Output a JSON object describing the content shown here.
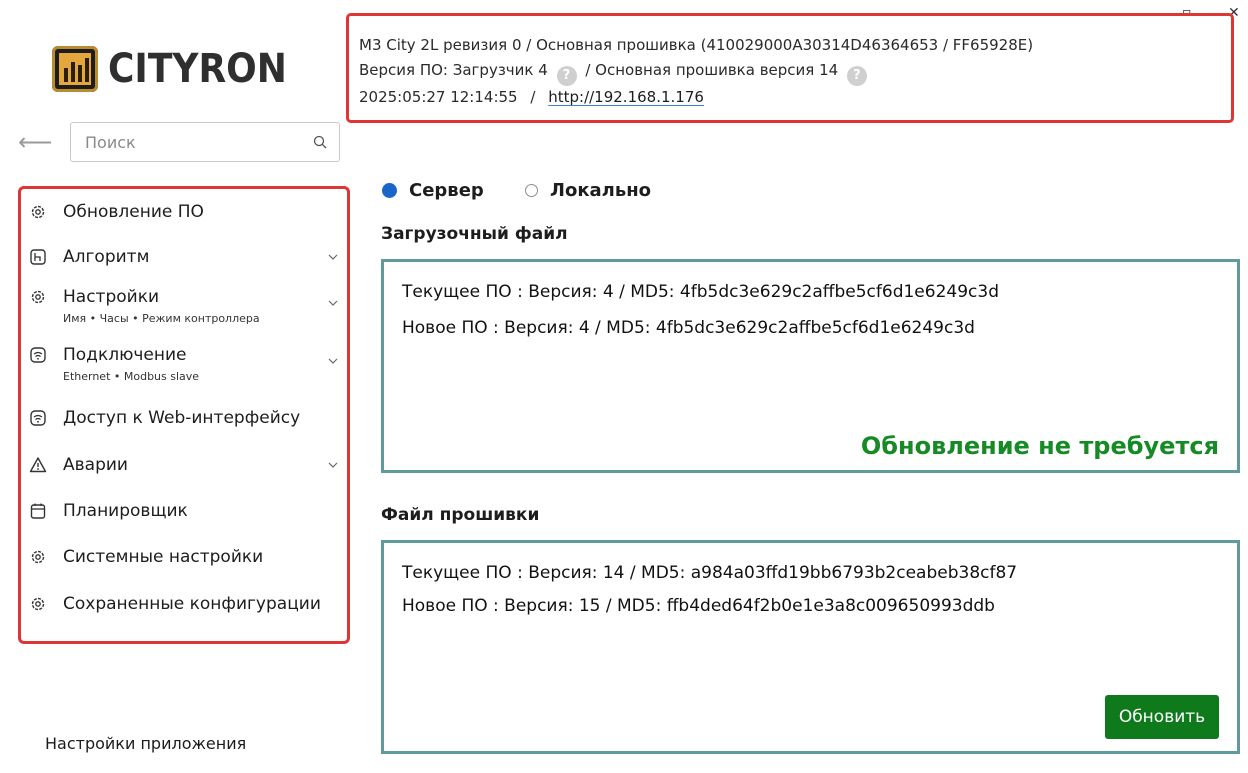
{
  "app": {
    "logo_text": "CITYRON",
    "window_restore": "▫",
    "window_close": "✕"
  },
  "search": {
    "placeholder": "Поиск"
  },
  "sidebar": {
    "items": [
      {
        "label": "Обновление ПО",
        "icon": "gear-icon"
      },
      {
        "label": "Алгоритм",
        "icon": "algorithm-icon",
        "expandable": true
      },
      {
        "label": "Настройки",
        "sub": "Имя • Часы • Режим контроллера",
        "icon": "gear-icon",
        "expandable": true
      },
      {
        "label": "Подключение",
        "sub": "Ethernet • Modbus slave",
        "icon": "wifi-icon",
        "expandable": true
      },
      {
        "label": "Доступ к Web-интерфейсу",
        "icon": "wifi-icon"
      },
      {
        "label": "Аварии",
        "icon": "warning-icon",
        "expandable": true
      },
      {
        "label": "Планировщик",
        "icon": "calendar-icon"
      },
      {
        "label": "Системные настройки",
        "icon": "gear-icon"
      },
      {
        "label": "Сохраненные конфигурации",
        "icon": "gear-icon"
      }
    ],
    "app_settings": "Настройки приложения"
  },
  "header": {
    "device": "M3 City 2L ревизия 0 / Основная прошивка (410029000A30314D46364653 / FF65928E)",
    "fw_prefix": "Версия ПО: Загрузчик 4",
    "fw_main": "/ Основная прошивка версия 14",
    "datetime": "2025:05:27 12:14:55",
    "separator": "/",
    "url": "http://192.168.1.176",
    "help_glyph": "?"
  },
  "source": {
    "server": "Сервер",
    "local": "Локально",
    "selected": "server"
  },
  "bootloader": {
    "title": "Загрузочный файл",
    "current": "Текущее ПО : Версия: 4 / MD5: 4fb5dc3e629c2affbe5cf6d1e6249c3d",
    "new": "Новое ПО : Версия: 4 / MD5: 4fb5dc3e629c2affbe5cf6d1e6249c3d",
    "status": "Обновление не требуется"
  },
  "firmware": {
    "title": "Файл прошивки",
    "current": "Текущее ПО : Версия: 14 / MD5: a984a03ffd19bb6793b2ceabeb38cf87",
    "new": "Новое ПО : Версия: 15 / MD5: ffb4ded64f2b0e1e3a8c009650993ddb",
    "update_button": "Обновить"
  },
  "colors": {
    "highlight_border": "#e03535",
    "panel_border": "#5f9a9c",
    "status_ok": "#168a24",
    "button_bg": "#0e7a1b",
    "radio_selected": "#1a66c8"
  }
}
